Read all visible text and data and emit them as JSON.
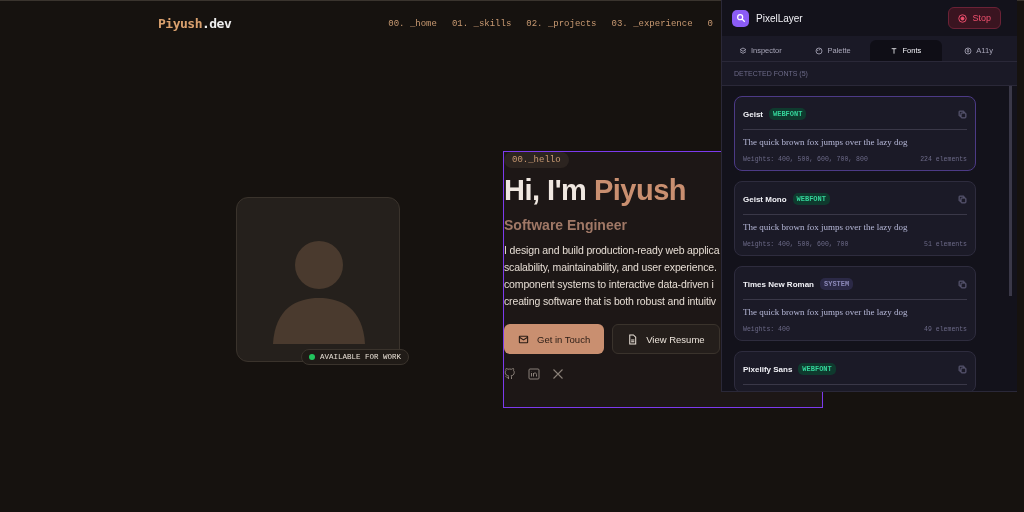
{
  "nav": {
    "logo": {
      "name": "Piyush",
      "suffix": ".dev"
    },
    "links": [
      {
        "label": "00. _home"
      },
      {
        "label": "01. _skills"
      },
      {
        "label": "02. _projects"
      },
      {
        "label": "03. _experience"
      },
      {
        "label": "0"
      }
    ]
  },
  "profile": {
    "status": "AVAILABLE FOR WORK"
  },
  "hero": {
    "tag": "00._hello",
    "heading": {
      "text": "Hi, I'm ",
      "highlight": "Piyush"
    },
    "subtitle": "Software Engineer",
    "bio": "I design and build production-ready web applica\nscalability, maintainability, and user experience.\ncomponent systems to interactive data-driven i\ncreating software that is both robust and intuitiv",
    "buttons": [
      {
        "label": "Get in Touch",
        "kind": "primary"
      },
      {
        "label": "View Resume",
        "kind": "secondary"
      }
    ]
  },
  "panel": {
    "title": "PixelLayer",
    "stop": "Stop",
    "tabs": [
      {
        "label": "Inspector",
        "selected": false
      },
      {
        "label": "Palette",
        "selected": false
      },
      {
        "label": "Fonts",
        "selected": true
      },
      {
        "label": "A11y",
        "selected": false
      }
    ],
    "section": "DETECTED FONTS (5)",
    "fonts": [
      {
        "name": "Geist",
        "badge": "WEBFONT",
        "kind": "webfont",
        "selected": true,
        "sample": "The quick brown fox jumps over the lazy dog",
        "weights": "Weights: 400, 500, 600, 700, 800",
        "count": "224 elements"
      },
      {
        "name": "Geist Mono",
        "badge": "WEBFONT",
        "kind": "webfont",
        "selected": false,
        "sample": "The quick brown fox jumps over the lazy dog",
        "weights": "Weights: 400, 500, 600, 700",
        "count": "51 elements"
      },
      {
        "name": "Times New Roman",
        "badge": "SYSTEM",
        "kind": "system",
        "selected": false,
        "sample": "The quick brown fox jumps over the lazy dog",
        "weights": "Weights: 400",
        "count": "49 elements"
      },
      {
        "name": "Pixelify Sans",
        "badge": "WEBFONT",
        "kind": "webfont",
        "selected": false
      }
    ]
  }
}
